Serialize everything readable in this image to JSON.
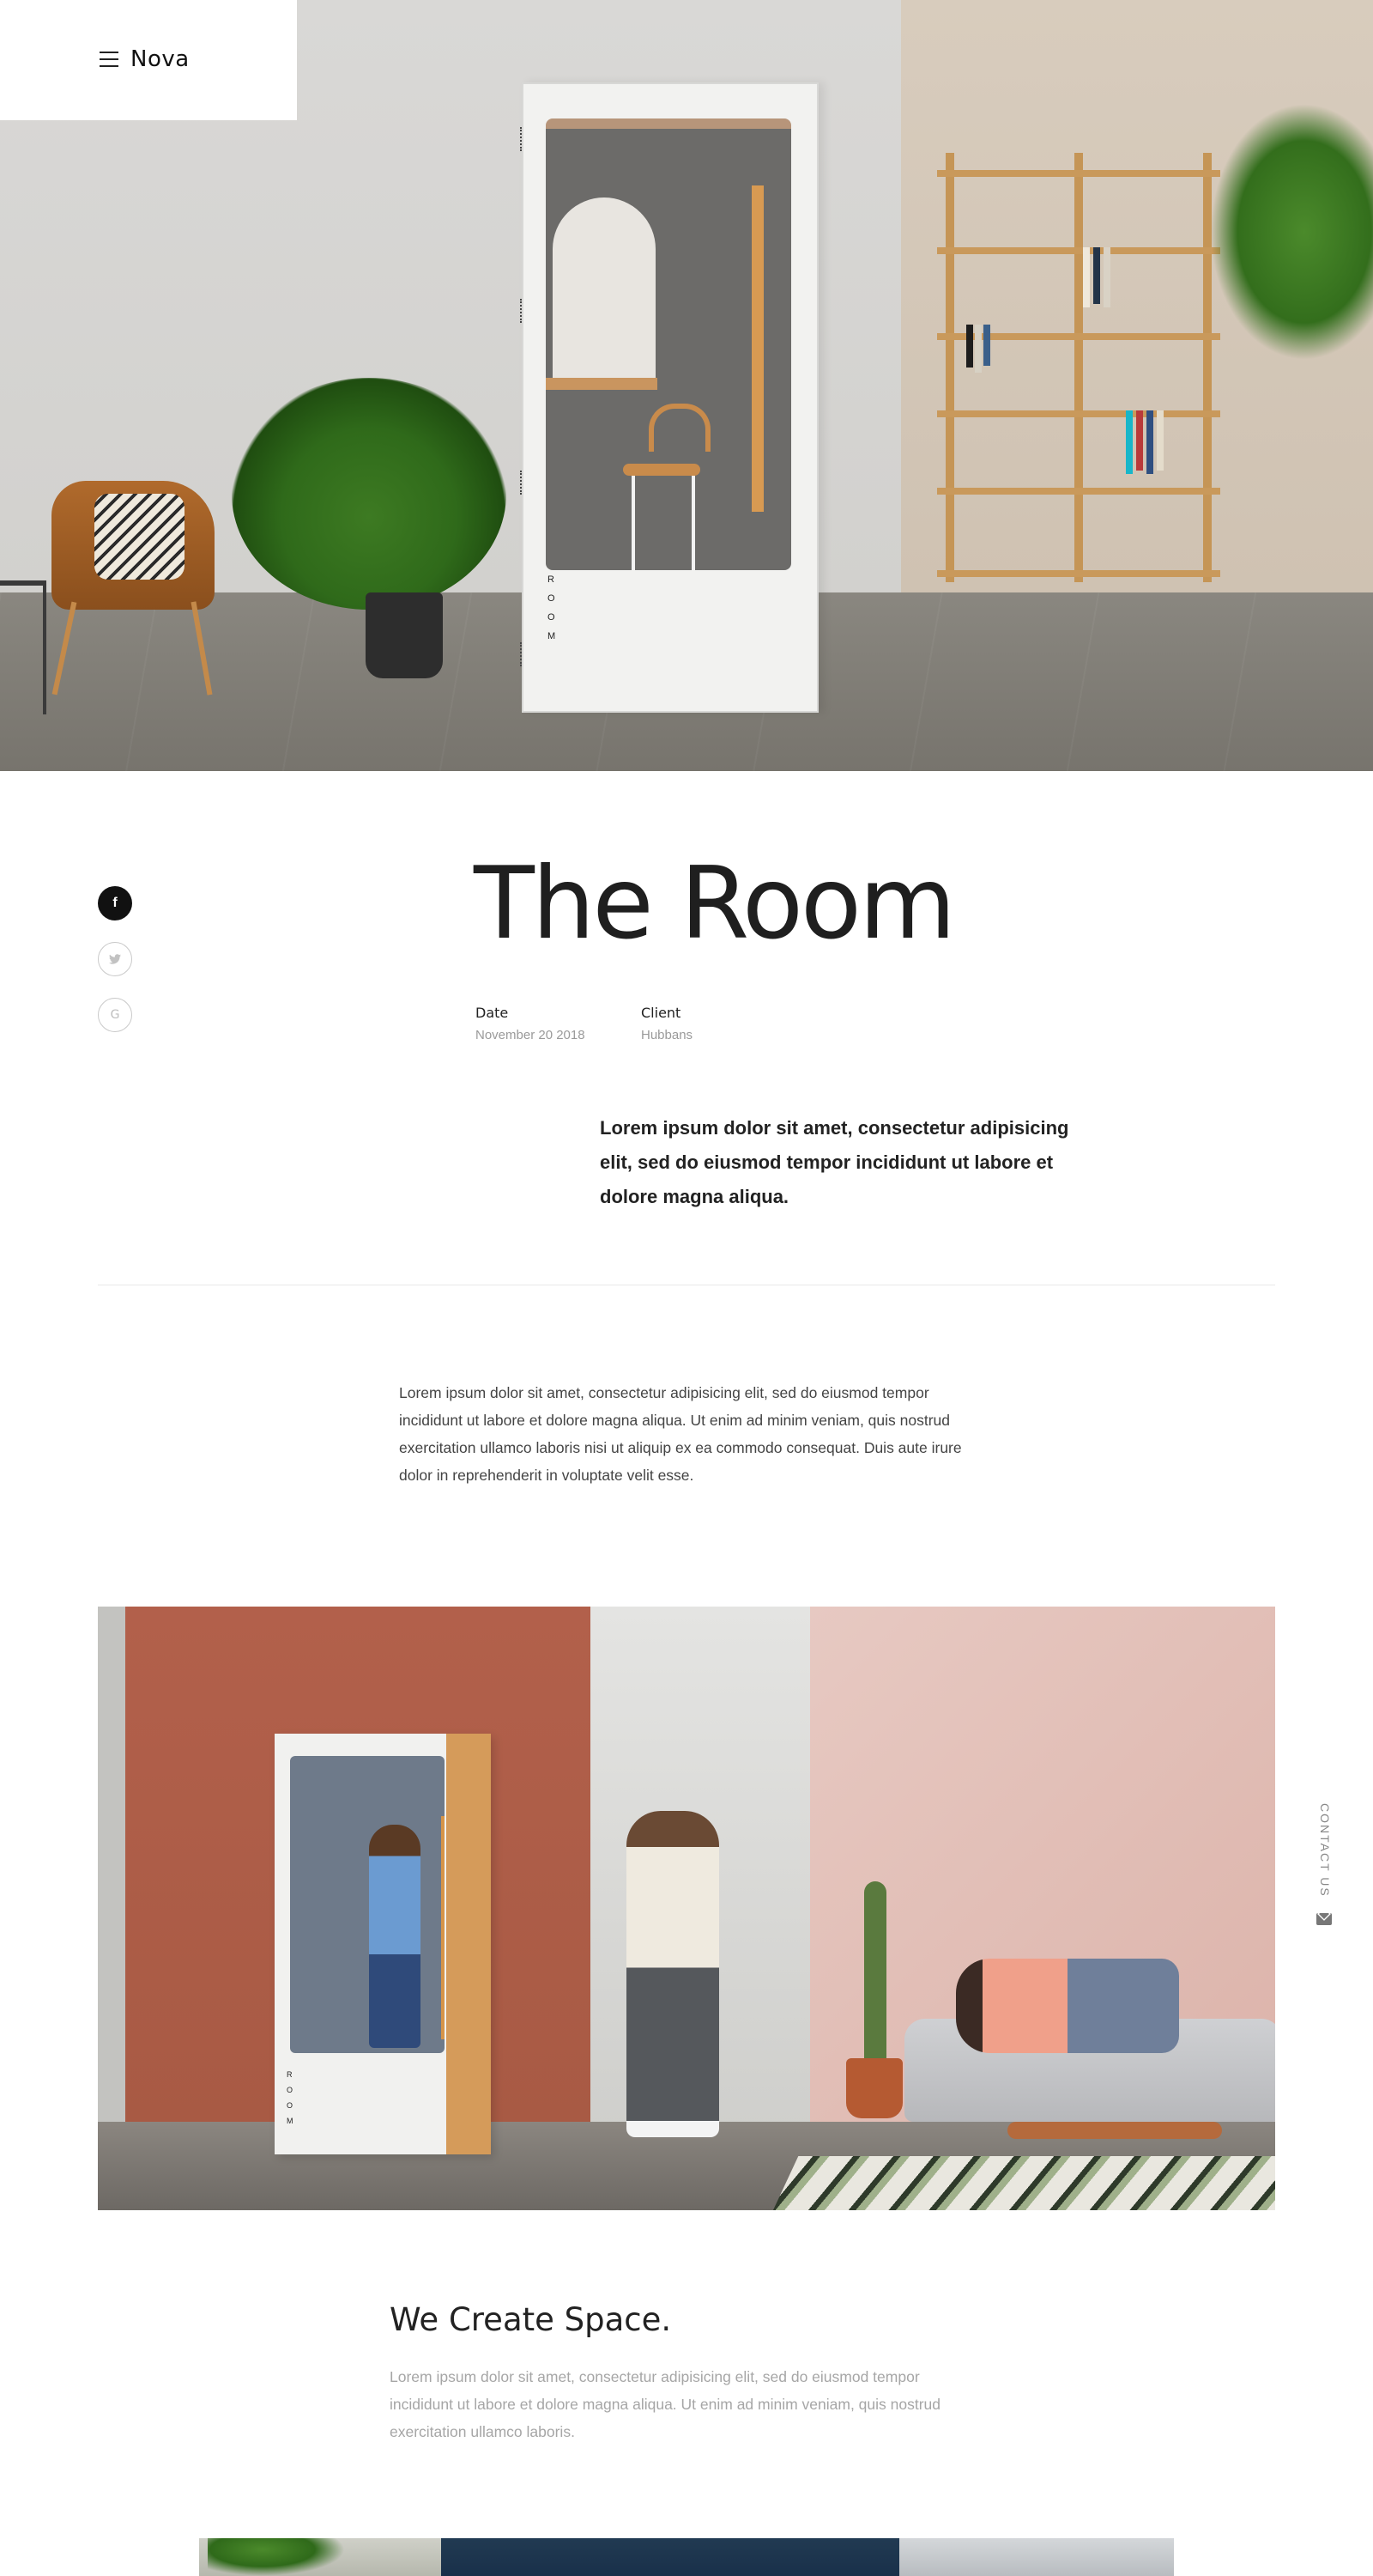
{
  "header": {
    "brand": "Nova",
    "menu_icon": "hamburger-menu-icon"
  },
  "hero": {
    "booth_letters": "R O O M"
  },
  "social": [
    {
      "name": "facebook",
      "glyph": "f",
      "icon": "facebook-icon"
    },
    {
      "name": "twitter",
      "glyph": "🐦",
      "icon": "twitter-icon"
    },
    {
      "name": "google",
      "glyph": "G",
      "icon": "google-icon"
    }
  ],
  "project": {
    "title": "The Room",
    "date_label": "Date",
    "date_value": "November 20 2018",
    "client_label": "Client",
    "client_value": "Hubbans",
    "lead": "Lorem ipsum dolor sit amet, consectetur adipisicing elit, sed do eiusmod tempor incididunt ut labore et dolore magna aliqua.",
    "body": "Lorem ipsum dolor sit amet, consectetur adipisicing elit, sed do eiusmod tempor incididunt ut labore et dolore magna aliqua. Ut enim ad minim veniam, quis nostrud exercitation ullamco laboris nisi ut aliquip ex ea commodo consequat. Duis aute irure dolor in reprehenderit in voluptate velit esse."
  },
  "feature": {
    "booth_letters": "R O O M"
  },
  "contact_tab": {
    "label": "CONTACT US",
    "icon": "envelope-icon"
  },
  "section": {
    "title": "We Create Space.",
    "text": "Lorem ipsum dolor sit amet, consectetur adipisicing elit, sed do eiusmod tempor incididunt ut labore et dolore magna aliqua. Ut enim ad minim veniam, quis nostrud exercitation ullamco laboris."
  },
  "colors": {
    "text_dark": "#1f1f1f",
    "text_muted": "#9a9a9a",
    "facebook_bg": "#111111"
  }
}
